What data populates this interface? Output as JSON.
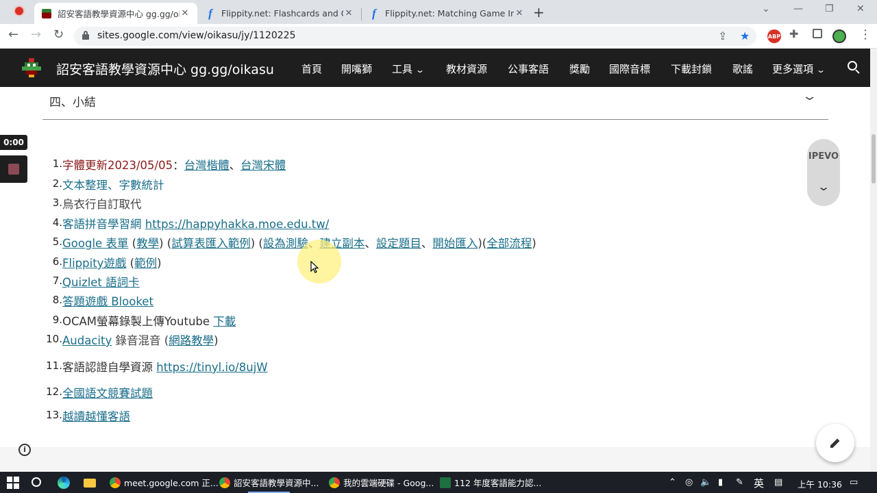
{
  "browser": {
    "tabs": [
      {
        "title": "詔安客語教學資源中心 gg.gg/oi",
        "active": true
      },
      {
        "title": "Flippity.net: Flashcards and Oth",
        "active": false
      },
      {
        "title": "Flippity.net: Matching Game In",
        "active": false
      }
    ],
    "url": "sites.google.com/view/oikasu/jy/1120225",
    "ext_abp": "ABP"
  },
  "site": {
    "title": "詔安客語教學資源中心 gg.gg/oikasu",
    "nav": [
      "首頁",
      "開嘴獅",
      "工具",
      "教材資源",
      "公事客語",
      "獎勵",
      "國際音標",
      "下載封鎖",
      "歌謠",
      "更多選項"
    ]
  },
  "section": {
    "heading": "四、小結"
  },
  "list": [
    {
      "num": "1.",
      "parts": [
        {
          "t": "字體更新2023/05/05",
          "s": "red"
        },
        {
          "t": "："
        },
        {
          "t": "台灣楷體",
          "link": true
        },
        {
          "t": "、"
        },
        {
          "t": "台灣宋體",
          "link": true
        }
      ]
    },
    {
      "num": "2.",
      "parts": [
        {
          "t": "文本整理、字數統計",
          "s": "link-plain"
        }
      ]
    },
    {
      "num": "3.",
      "parts": [
        {
          "t": "烏衣行自訂取代",
          "s": "grey"
        }
      ]
    },
    {
      "num": "4.",
      "parts": [
        {
          "t": "客語拼音學習網",
          "s": "link-plain"
        },
        {
          "t": " "
        },
        {
          "t": "https://happyhakka.moe.edu.tw/",
          "link": true
        }
      ]
    },
    {
      "num": "5.",
      "parts": [
        {
          "t": "Google 表單",
          "link": true
        },
        {
          "t": " ("
        },
        {
          "t": "教學",
          "link": true
        },
        {
          "t": ") ("
        },
        {
          "t": "試算表匯入範例",
          "link": true
        },
        {
          "t": ") ("
        },
        {
          "t": "設為測驗",
          "link": true
        },
        {
          "t": "、"
        },
        {
          "t": "建立副本",
          "link": true
        },
        {
          "t": "、"
        },
        {
          "t": "設定題目",
          "link": true
        },
        {
          "t": "、"
        },
        {
          "t": "開始匯入",
          "link": true
        },
        {
          "t": ")("
        },
        {
          "t": "全部流程",
          "link": true
        },
        {
          "t": ")"
        }
      ]
    },
    {
      "num": "6.",
      "parts": [
        {
          "t": "Flippity遊戲",
          "link": true
        },
        {
          "t": " ("
        },
        {
          "t": "範例",
          "link": true
        },
        {
          "t": ")"
        }
      ]
    },
    {
      "num": "7.",
      "parts": [
        {
          "t": "Quizlet 語詞卡",
          "link": true
        }
      ]
    },
    {
      "num": "8.",
      "parts": [
        {
          "t": "答題遊戲 Blooket",
          "link": true
        }
      ]
    },
    {
      "num": "9.",
      "parts": [
        {
          "t": "OCAM螢幕錄製上傳Youtube "
        },
        {
          "t": "下載",
          "link": true
        }
      ]
    },
    {
      "num": "10.",
      "parts": [
        {
          "t": "Audacity",
          "link": true
        },
        {
          "t": " 錄音混音 (",
          "s": "grey"
        },
        {
          "t": "網路教學",
          "link": true
        },
        {
          "t": ")"
        }
      ]
    },
    {
      "num": "11.",
      "parts": [
        {
          "t": "客語認證自學資源 "
        },
        {
          "t": "https://tinyl.io/8ujW",
          "link": true
        }
      ]
    },
    {
      "num": "12.",
      "parts": [
        {
          "t": "全國語文競賽試題",
          "link": true
        }
      ]
    },
    {
      "num": "13.",
      "parts": [
        {
          "t": "越讀越懂客語",
          "link": true
        }
      ]
    }
  ],
  "overlay": {
    "timer": "0:00",
    "ipevo": "IPEVO",
    "info": "i"
  },
  "taskbar": {
    "apps": [
      {
        "label": "meet.google.com 正...",
        "color": "#ea4335"
      },
      {
        "label": "詔安客語教學資源中...",
        "color": "#fbbc05"
      },
      {
        "label": "我的雲端硬碟 - Goog...",
        "color": "#34a853"
      },
      {
        "label": "112 年度客語能力認...",
        "color": "#1d6f42"
      }
    ],
    "ime": "英",
    "clock": "上午 10:36"
  }
}
